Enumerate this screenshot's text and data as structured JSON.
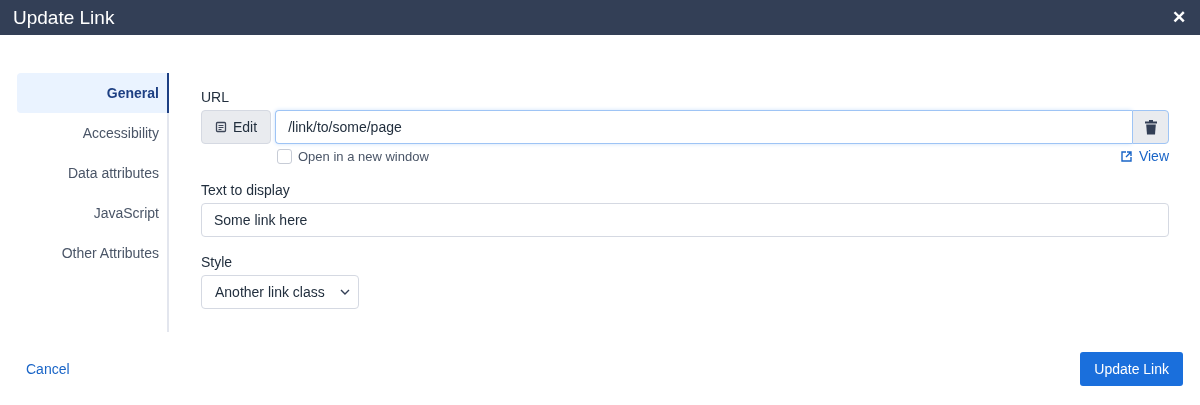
{
  "window": {
    "title": "Update Link",
    "close": "✕"
  },
  "tabs": [
    {
      "label": "General",
      "selected": true
    },
    {
      "label": "Accessibility",
      "selected": false
    },
    {
      "label": "Data attributes",
      "selected": false
    },
    {
      "label": "JavaScript",
      "selected": false
    },
    {
      "label": "Other Attributes",
      "selected": false
    }
  ],
  "url": {
    "label": "URL",
    "edit_button": "Edit",
    "value": "/link/to/some/page",
    "new_window": {
      "label": "Open in a new window",
      "checked": false
    },
    "view_link": "View"
  },
  "text_to_display": {
    "label": "Text to display",
    "value": "Some link here"
  },
  "style": {
    "label": "Style",
    "value": "Another link class"
  },
  "footer": {
    "cancel": "Cancel",
    "submit": "Update Link"
  }
}
